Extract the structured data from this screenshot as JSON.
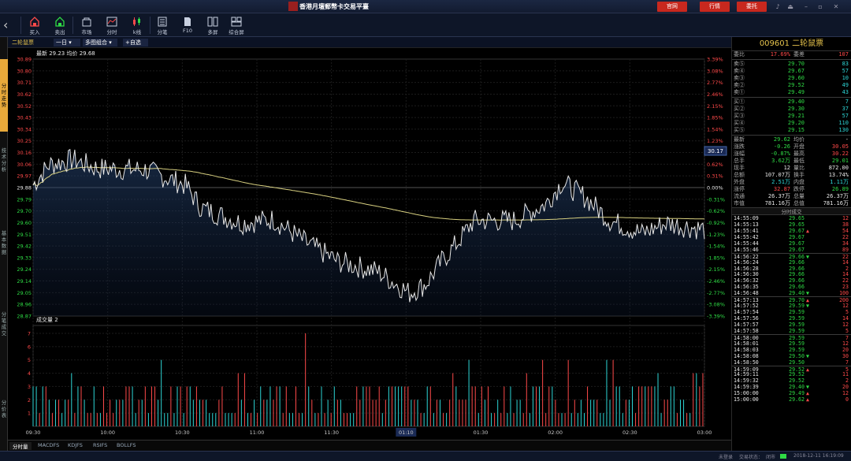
{
  "app": {
    "title": "香港月壇郵幣卡交易平臺",
    "top_buttons": [
      "官网",
      "行情",
      "委托"
    ]
  },
  "toolbar": {
    "items": [
      {
        "label": "买入",
        "icon": "buy-icon"
      },
      {
        "label": "卖出",
        "icon": "sell-icon"
      },
      {
        "label": "市场",
        "icon": "market-icon"
      },
      {
        "label": "分时",
        "icon": "timeshare-icon"
      },
      {
        "label": "k线",
        "icon": "kline-icon"
      },
      {
        "label": "分笔",
        "icon": "ticks-icon"
      },
      {
        "label": "F10",
        "icon": "f10-icon"
      },
      {
        "label": "多屏",
        "icon": "multiscreen-icon"
      },
      {
        "label": "综合屏",
        "icon": "composite-icon"
      }
    ]
  },
  "left_tabs": [
    "分时走势",
    "技术分析",
    "基本数据",
    "分笔成交",
    "分价表"
  ],
  "subheader": {
    "stock_name": "二轮鼠票",
    "period": "一日",
    "overlay": "多图组合",
    "watch": "+自选"
  },
  "price_chart": {
    "latest_label": "最新",
    "latest": "29.23",
    "avg_label": "均价",
    "avg": "29.68",
    "current_tag": "30.17",
    "y_left": [
      "30.89",
      "30.80",
      "30.71",
      "30.62",
      "30.52",
      "30.43",
      "30.34",
      "30.25",
      "30.16",
      "30.06",
      "29.97",
      "29.88",
      "29.79",
      "29.70",
      "29.60",
      "29.51",
      "29.42",
      "29.33",
      "29.24",
      "29.14",
      "29.05",
      "28.96",
      "28.87"
    ],
    "y_right": [
      "3.39%",
      "3.08%",
      "2.77%",
      "2.46%",
      "2.15%",
      "1.85%",
      "1.54%",
      "1.23%",
      "0.92%",
      "0.62%",
      "0.31%",
      "0.00%",
      "-0.31%",
      "-0.62%",
      "-0.92%",
      "-1.23%",
      "-1.54%",
      "-1.85%",
      "-2.15%",
      "-2.46%",
      "-2.77%",
      "-3.08%",
      "-3.39%"
    ]
  },
  "volume_chart": {
    "label": "成交量",
    "value": "2",
    "y_labels": [
      "7",
      "6",
      "5",
      "4",
      "3",
      "2",
      "1"
    ]
  },
  "time_axis": {
    "labels": [
      "09:30",
      "10:00",
      "10:30",
      "11:00",
      "11:30",
      "01:10",
      "01:30",
      "02:00",
      "02:30",
      "03:00"
    ]
  },
  "bottom_tabs": [
    "分时量",
    "MACDFS",
    "KDJFS",
    "RSIFS",
    "BOLLFS"
  ],
  "status": {
    "left": "未登录",
    "mid": "交易状态：",
    "state": "闭市",
    "datetime": "2018-12-11 16:19:09"
  },
  "quote": {
    "code_name": "009601 二轮鼠票",
    "wb_label": "委比",
    "wb": "17.69%",
    "wc_label": "委差",
    "wc": "107",
    "asks": [
      {
        "label": "卖⑤",
        "price": "29.70",
        "vol": "83"
      },
      {
        "label": "卖④",
        "price": "29.67",
        "vol": "57"
      },
      {
        "label": "卖③",
        "price": "29.60",
        "vol": "10"
      },
      {
        "label": "卖②",
        "price": "29.52",
        "vol": "49"
      },
      {
        "label": "卖①",
        "price": "29.49",
        "vol": "43"
      }
    ],
    "bids": [
      {
        "label": "买①",
        "price": "29.40",
        "vol": "7"
      },
      {
        "label": "买②",
        "price": "29.30",
        "vol": "37"
      },
      {
        "label": "买③",
        "price": "29.21",
        "vol": "57"
      },
      {
        "label": "买④",
        "price": "29.20",
        "vol": "110"
      },
      {
        "label": "买⑤",
        "price": "29.15",
        "vol": "130"
      }
    ],
    "stats": [
      {
        "l1": "最新",
        "v1": "29.62",
        "l2": "均价",
        "v2": "-"
      },
      {
        "l1": "涨跌",
        "v1": "-0.26",
        "l2": "开盘",
        "v2": "30.05"
      },
      {
        "l1": "涨幅",
        "v1": "-0.87%",
        "l2": "最高",
        "v2": "30.22"
      },
      {
        "l1": "总手",
        "v1": "3.62万",
        "l2": "最低",
        "v2": "29.01"
      },
      {
        "l1": "现手",
        "v1": "12",
        "l2": "量比",
        "v2": "872.00"
      },
      {
        "l1": "总额",
        "v1": "107.07万",
        "l2": "换手",
        "v2": "13.74%"
      },
      {
        "l1": "外盘",
        "v1": "2.51万",
        "l2": "内盘",
        "v2": "1.11万"
      },
      {
        "l1": "涨停",
        "v1": "32.87",
        "l2": "跌停",
        "v2": "26.89"
      },
      {
        "l1": "流通",
        "v1": "26.37万",
        "l2": "总量",
        "v2": "26.37万"
      },
      {
        "l1": "市值",
        "v1": "781.16万",
        "l2": "总值",
        "v2": "781.16万"
      }
    ]
  },
  "ticks": {
    "header": "分时成交",
    "rows": [
      {
        "t": "14:55:09",
        "p": "29.65",
        "d": "",
        "v": "12"
      },
      {
        "t": "14:55:13",
        "p": "29.65",
        "d": "",
        "v": "38"
      },
      {
        "t": "14:55:41",
        "p": "29.67",
        "d": "up",
        "v": "54"
      },
      {
        "t": "14:55:42",
        "p": "29.67",
        "d": "",
        "v": "22"
      },
      {
        "t": "14:55:44",
        "p": "29.67",
        "d": "",
        "v": "34"
      },
      {
        "t": "14:55:46",
        "p": "29.67",
        "d": "",
        "v": "89"
      },
      {
        "t": "14:56:22",
        "p": "29.66",
        "d": "down",
        "v": "22"
      },
      {
        "t": "14:56:24",
        "p": "29.66",
        "d": "",
        "v": "14"
      },
      {
        "t": "14:56:28",
        "p": "29.66",
        "d": "",
        "v": "2"
      },
      {
        "t": "14:56:30",
        "p": "29.66",
        "d": "",
        "v": "14"
      },
      {
        "t": "14:56:32",
        "p": "29.66",
        "d": "",
        "v": "22"
      },
      {
        "t": "14:56:35",
        "p": "29.66",
        "d": "",
        "v": "23"
      },
      {
        "t": "14:56:48",
        "p": "29.40",
        "d": "down",
        "v": "100"
      },
      {
        "t": "14:57:13",
        "p": "29.70",
        "d": "up",
        "v": "200"
      },
      {
        "t": "14:57:52",
        "p": "29.59",
        "d": "down",
        "v": "12"
      },
      {
        "t": "14:57:54",
        "p": "29.59",
        "d": "",
        "v": "5"
      },
      {
        "t": "14:57:56",
        "p": "29.59",
        "d": "",
        "v": "14"
      },
      {
        "t": "14:57:57",
        "p": "29.59",
        "d": "",
        "v": "12"
      },
      {
        "t": "14:57:58",
        "p": "29.59",
        "d": "",
        "v": "5"
      },
      {
        "t": "14:58:00",
        "p": "29.59",
        "d": "",
        "v": "7"
      },
      {
        "t": "14:58:01",
        "p": "29.59",
        "d": "",
        "v": "12"
      },
      {
        "t": "14:58:03",
        "p": "29.59",
        "d": "",
        "v": "20"
      },
      {
        "t": "14:58:08",
        "p": "29.50",
        "d": "down",
        "v": "30"
      },
      {
        "t": "14:58:50",
        "p": "29.50",
        "d": "",
        "v": "7"
      },
      {
        "t": "14:59:09",
        "p": "29.52",
        "d": "up",
        "v": "5"
      },
      {
        "t": "14:59:11",
        "p": "29.52",
        "d": "",
        "v": "11"
      },
      {
        "t": "14:59:32",
        "p": "29.52",
        "d": "",
        "v": "2"
      },
      {
        "t": "14:59:39",
        "p": "29.40",
        "d": "down",
        "v": "20"
      },
      {
        "t": "15:00:00",
        "p": "29.49",
        "d": "up",
        "v": "12"
      },
      {
        "t": "15:00:00",
        "p": "29.62",
        "d": "up",
        "v": "0"
      }
    ]
  },
  "colors": {
    "up": "#ff4a4a",
    "down": "#2fdc45",
    "price_line": "#e8e8e8",
    "avg_line": "#d8d080",
    "accent": "#e8a93a"
  }
}
